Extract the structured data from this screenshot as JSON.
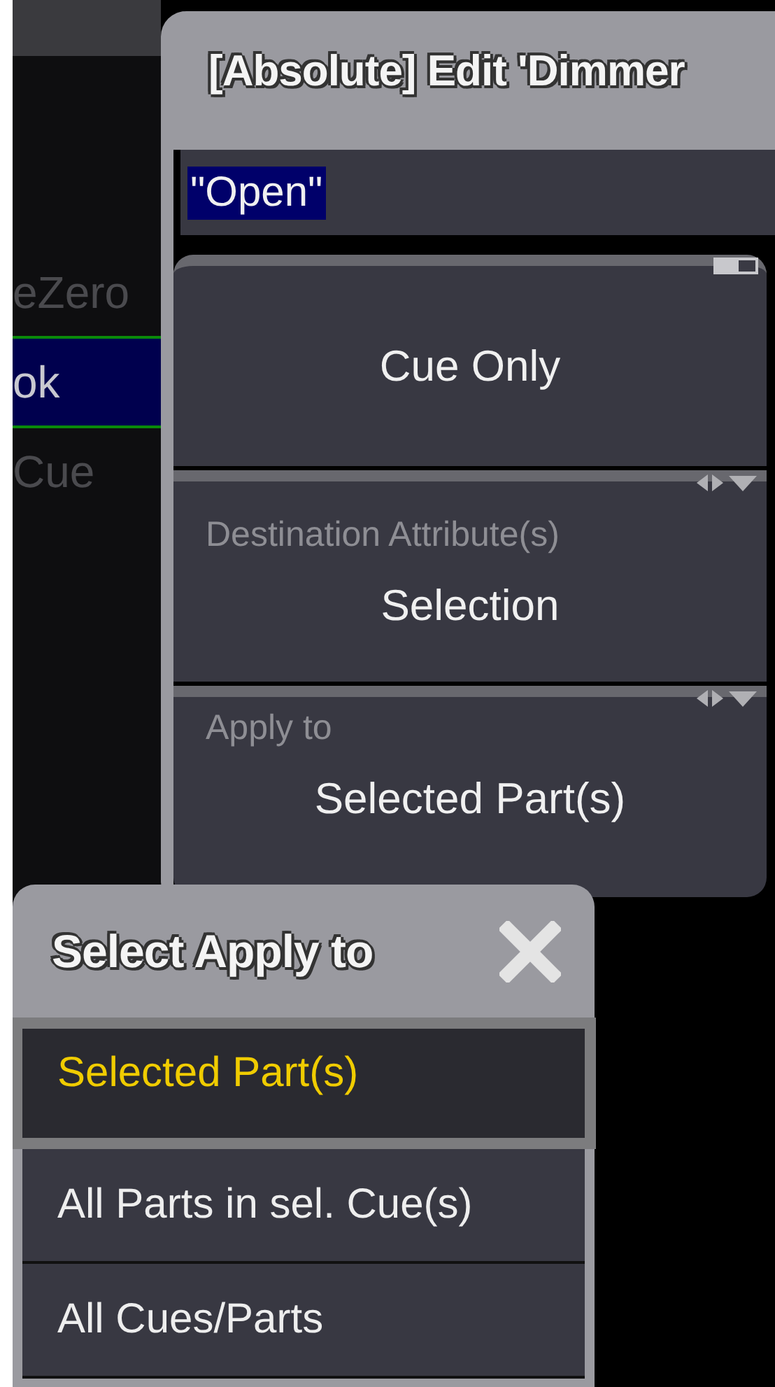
{
  "background_list": {
    "rows": [
      {
        "label": "eZero",
        "selected": false
      },
      {
        "label": "ok",
        "selected": true
      },
      {
        "label": "Cue",
        "selected": false
      }
    ]
  },
  "edit_dialog": {
    "title": "[Absolute] Edit 'Dimmer",
    "input": {
      "value": "\"Open\"",
      "text_selected": true
    },
    "cards": [
      {
        "kind": "toggle",
        "value": "Cue Only"
      },
      {
        "kind": "select",
        "label": "Destination Attribute(s)",
        "value": "Selection"
      },
      {
        "kind": "select",
        "label": "Apply to",
        "value": "Selected Part(s)"
      }
    ]
  },
  "select_popup": {
    "title": "Select Apply to",
    "items": [
      {
        "label": "Selected Part(s)",
        "selected": true
      },
      {
        "label": "All Parts in sel. Cue(s)",
        "selected": false
      },
      {
        "label": "All Cues/Parts",
        "selected": false
      }
    ]
  }
}
